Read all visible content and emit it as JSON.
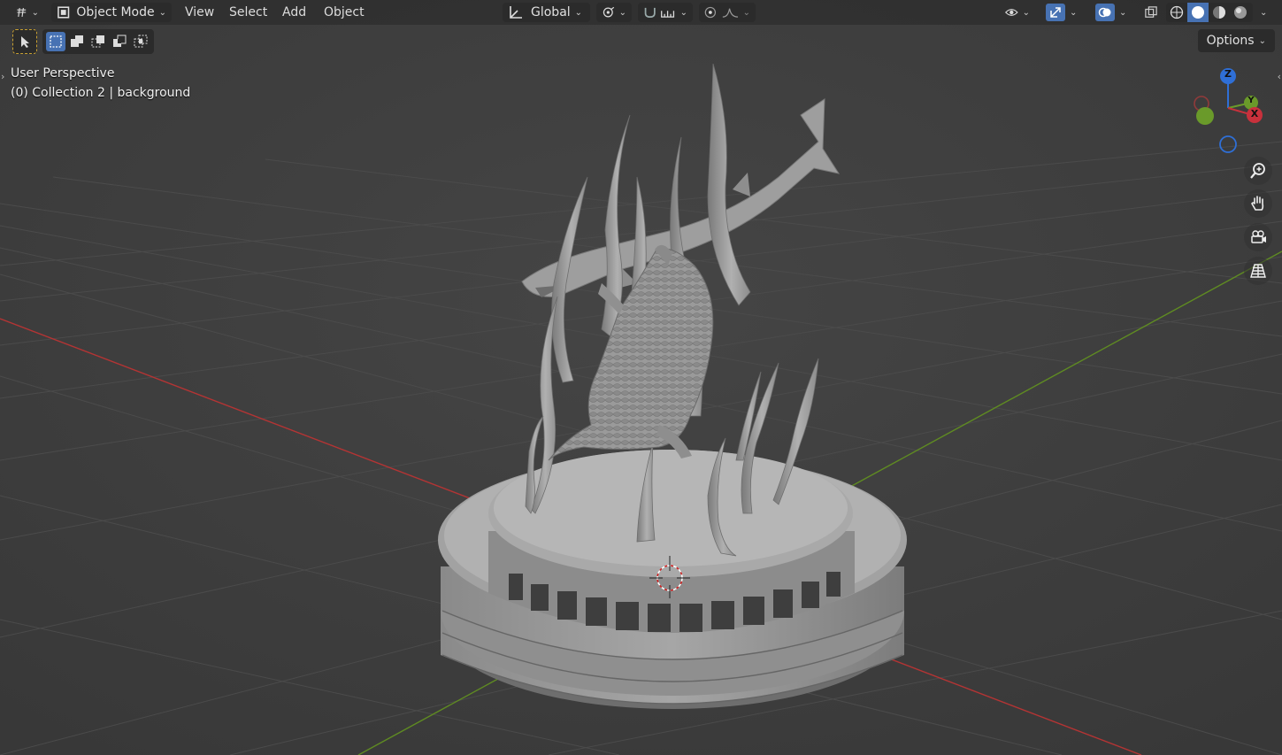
{
  "header": {
    "editor_type_icon": "editor-type-icon",
    "mode_label": "Object Mode",
    "menus": [
      "View",
      "Select",
      "Add",
      "Object"
    ],
    "transform_orientation": "Global",
    "options_label": "Options"
  },
  "overlay": {
    "view_name": "User Perspective",
    "collection_info": "(0) Collection 2 | background"
  },
  "gizmo": {
    "z_label": "Z",
    "y_label": "Y",
    "x_label": "X"
  },
  "colors": {
    "accent": "#4772b3",
    "x_axis": "#c8313c",
    "y_axis": "#6a9a2a",
    "z_axis": "#2f6fd6",
    "background": "#3d3d3d"
  },
  "icons": {
    "nav": [
      "zoom-icon",
      "pan-hand-icon",
      "camera-icon",
      "ortho-grid-icon"
    ]
  }
}
